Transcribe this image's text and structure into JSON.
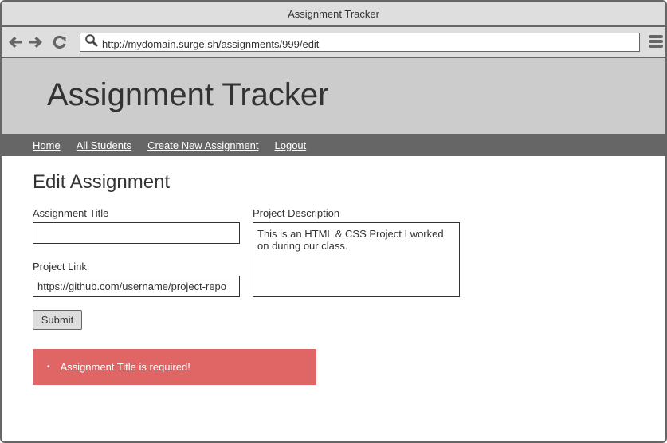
{
  "browser": {
    "window_title": "Assignment Tracker",
    "url": "http://mydomain.surge.sh/assignments/999/edit",
    "icons": {
      "back": "arrow-left-icon",
      "forward": "arrow-right-icon",
      "reload": "reload-icon",
      "search": "search-icon",
      "menu": "hamburger-menu-icon"
    }
  },
  "header": {
    "title": "Assignment Tracker"
  },
  "nav": {
    "items": [
      {
        "label": "Home"
      },
      {
        "label": "All Students"
      },
      {
        "label": "Create New Assignment"
      },
      {
        "label": "Logout"
      }
    ]
  },
  "form": {
    "heading": "Edit Assignment",
    "assignment_title": {
      "label": "Assignment Title",
      "value": ""
    },
    "project_link": {
      "label": "Project Link",
      "value": "https://github.com/username/project-repo"
    },
    "project_description": {
      "label": "Project Description",
      "value": "This is an HTML & CSS Project I worked on during our class."
    },
    "submit_label": "Submit"
  },
  "errors": {
    "items": [
      "Assignment Title is required!"
    ],
    "bullet": "•"
  },
  "colors": {
    "header_bg": "#cccccc",
    "nav_bg": "#666666",
    "error_bg": "#e06666",
    "text": "#333333"
  }
}
